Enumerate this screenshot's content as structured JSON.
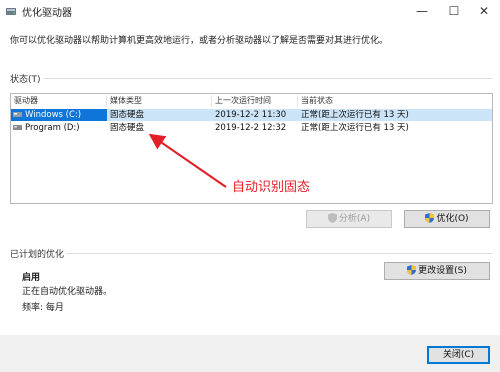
{
  "window": {
    "title": "优化驱动器",
    "controls": {
      "minimize": "—",
      "maximize": "☐",
      "close": "✕"
    }
  },
  "description": "你可以优化驱动器以帮助计算机更高效地运行，或者分析驱动器以了解是否需要对其进行优化。",
  "status_section": {
    "label": "状态(T)",
    "columns": [
      "驱动器",
      "媒体类型",
      "上一次运行时间",
      "当前状态"
    ],
    "rows": [
      {
        "drive": "Windows (C:)",
        "media": "固态硬盘",
        "last_run": "2019-12-2 11:30",
        "status": "正常(距上次运行已有 13 天)",
        "selected": true
      },
      {
        "drive": "Program (D:)",
        "media": "固态硬盘",
        "last_run": "2019-12-2 12:32",
        "status": "正常(距上次运行已有 13 天)",
        "selected": false
      }
    ]
  },
  "annotation": {
    "text": "自动识别固态",
    "color": "#e21f26"
  },
  "buttons": {
    "analyze": "分析(A)",
    "optimize": "优化(O)",
    "change_settings": "更改设置(S)",
    "close": "关闭(C)"
  },
  "scheduled_section": {
    "label": "已计划的优化",
    "state": "启用",
    "detail": "正在自动优化驱动器。",
    "frequency": "频率: 每月"
  },
  "colors": {
    "selection": "#0f75d8",
    "accent_border": "#0078d7"
  }
}
